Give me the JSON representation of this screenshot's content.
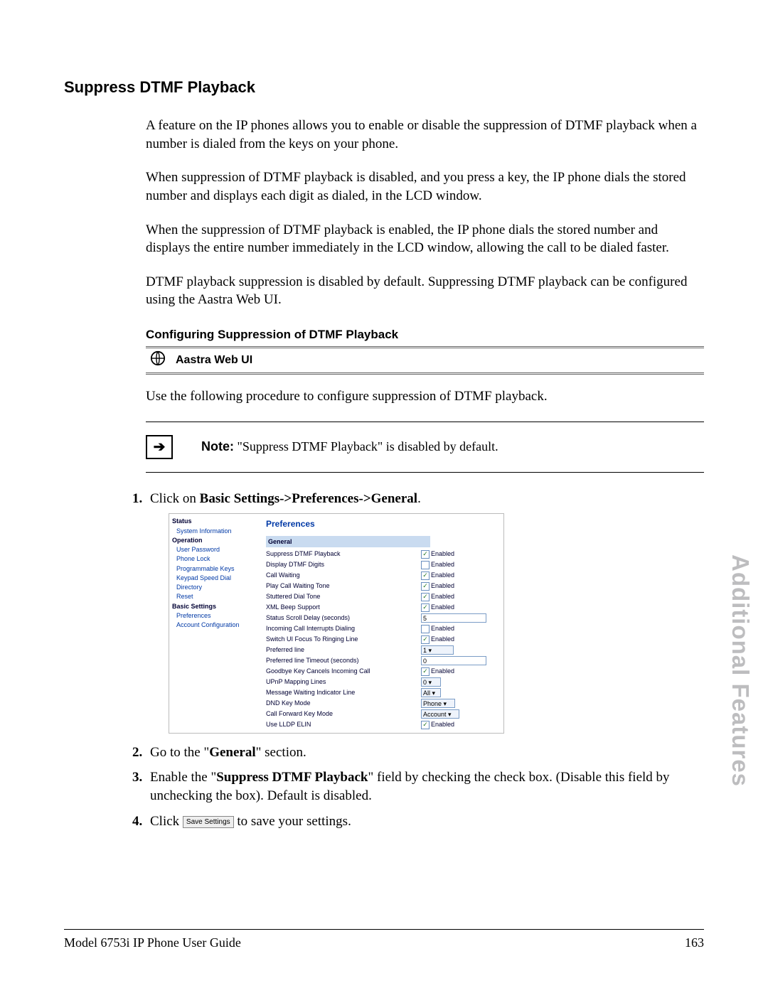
{
  "heading": "Suppress DTMF Playback",
  "paragraphs": {
    "p1": "A feature on the IP phones allows you to enable or disable the suppression of DTMF playback when a number is dialed from the keys on your phone.",
    "p2": "When suppression of DTMF playback is disabled, and you press a key, the IP phone dials the stored number and displays each digit as dialed, in the LCD window.",
    "p3": "When the suppression of DTMF playback is enabled, the IP phone dials the stored number and displays the entire number immediately in the LCD window, allowing the call to be dialed faster.",
    "p4": "DTMF playback suppression is disabled by default. Suppressing DTMF playback can be configured using the Aastra Web UI."
  },
  "subheading": "Configuring Suppression of DTMF Playback",
  "aastra_label": "Aastra Web UI",
  "procedure_intro": "Use the following procedure to configure suppression of DTMF playback.",
  "note": {
    "label": "Note:",
    "text": "\"Suppress DTMF Playback\" is disabled by default."
  },
  "steps": {
    "s1_pre": "Click on ",
    "s1_bold": "Basic Settings->Preferences->General",
    "s1_post": ".",
    "s2_pre": "Go to the \"",
    "s2_bold": "General",
    "s2_post": "\" section.",
    "s3_pre": "Enable the \"",
    "s3_bold": "Suppress DTMF Playback",
    "s3_post": "\" field by checking the check box. (Disable this field by unchecking the box). Default is disabled.",
    "s4_pre": "Click ",
    "s4_btn": "Save Settings",
    "s4_post": " to save your settings."
  },
  "screenshot": {
    "sidebar": {
      "status": "Status",
      "sysinfo": "System Information",
      "operation": "Operation",
      "userpw": "User Password",
      "phonelock": "Phone Lock",
      "progkeys": "Programmable Keys",
      "keypadsd": "Keypad Speed Dial",
      "directory": "Directory",
      "reset": "Reset",
      "basicsettings": "Basic Settings",
      "preferences": "Preferences",
      "acctconf": "Account Configuration"
    },
    "main_title": "Preferences",
    "section_general": "General",
    "rows": {
      "suppress": "Suppress DTMF Playback",
      "display": "Display DTMF Digits",
      "callwaiting": "Call Waiting",
      "playcwt": "Play Call Waiting Tone",
      "stuttered": "Stuttered Dial Tone",
      "xmlbeep": "XML Beep Support",
      "statusscroll": "Status Scroll Delay (seconds)",
      "incoming": "Incoming Call Interrupts Dialing",
      "switchui": "Switch UI Focus To Ringing Line",
      "prefline": "Preferred line",
      "preflinetimeout": "Preferred line Timeout (seconds)",
      "goodbye": "Goodbye Key Cancels Incoming Call",
      "upnp": "UPnP Mapping Lines",
      "mwi": "Message Waiting Indicator Line",
      "dnd": "DND Key Mode",
      "cfwd": "Call Forward Key Mode",
      "lldp": "Use LLDP ELIN"
    },
    "enabled_label": "Enabled",
    "values": {
      "status_scroll": "5",
      "pref_line": "1",
      "pref_line_timeout": "0",
      "upnp": "0",
      "mwi": "All",
      "dnd": "Phone",
      "cfwd": "Account"
    }
  },
  "side_tab": "Additional Features",
  "footer": {
    "left": "Model 6753i IP Phone User Guide",
    "right": "163"
  }
}
